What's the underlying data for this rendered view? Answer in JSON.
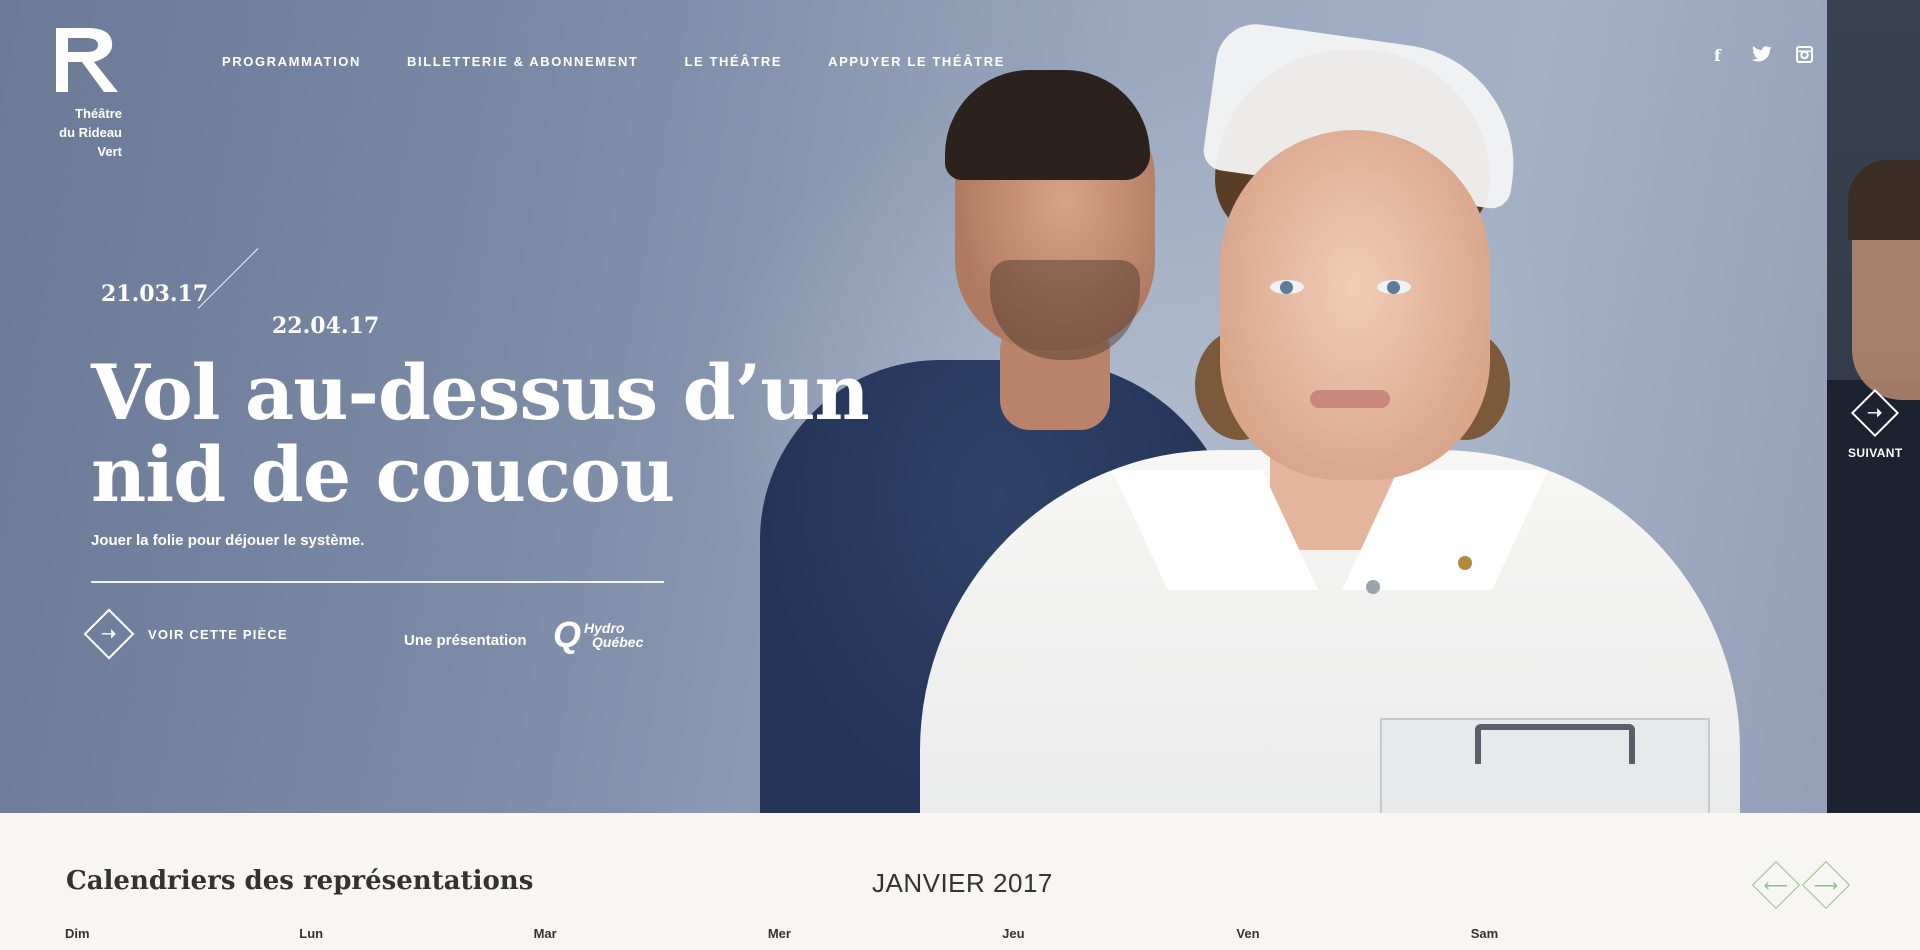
{
  "logo": {
    "lines": [
      "Théâtre",
      "du Rideau",
      "Vert"
    ]
  },
  "nav": [
    {
      "label": "PROGRAMMATION"
    },
    {
      "label": "BILLETTERIE & ABONNEMENT"
    },
    {
      "label": "LE THÉÂTRE"
    },
    {
      "label": "APPUYER LE THÉÂTRE"
    }
  ],
  "social": [
    {
      "icon": "facebook-icon",
      "glyph": "f"
    },
    {
      "icon": "twitter-icon",
      "glyph": "🐦"
    },
    {
      "icon": "instagram-icon",
      "glyph": "◙"
    }
  ],
  "hero": {
    "date_start": "21.03.17",
    "date_end": "22.04.17",
    "title_line1": "Vol au-dessus d’un",
    "title_line2": "nid de coucou",
    "tagline": "Jouer la folie pour déjouer le système.",
    "cta_label": "VOIR CETTE PIÈCE",
    "cta_icon": "arrow-right-diamond-icon",
    "presented_by": "Une présentation",
    "sponsor_line1": "Hydro",
    "sponsor_line2": "Québec",
    "next_label": "SUIVANT"
  },
  "calendar": {
    "title": "Calendriers des représentations",
    "month": "JANVIER 2017",
    "days": [
      "Dim",
      "Lun",
      "Mar",
      "Mer",
      "Jeu",
      "Ven",
      "Sam"
    ]
  },
  "colors": {
    "accent_green": "#8cc28a",
    "hero_blue": "#7c8ba6"
  }
}
